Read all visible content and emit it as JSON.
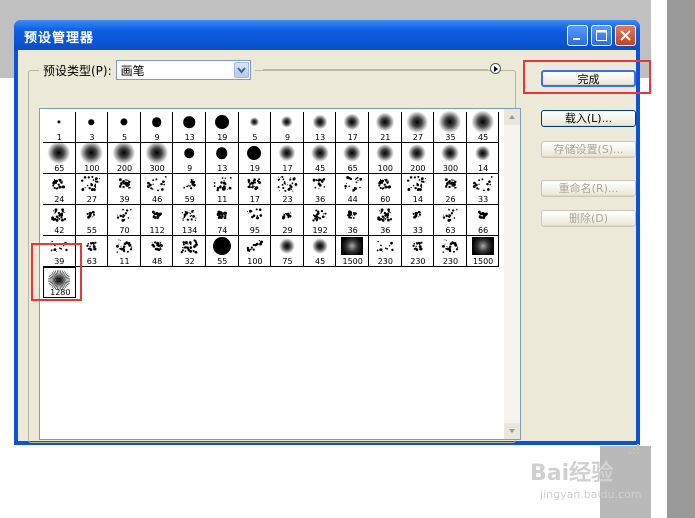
{
  "window": {
    "title": "预设管理器",
    "minimize": "minimize",
    "maximize": "maximize",
    "close": "close"
  },
  "preset_type": {
    "label": "预设类型(P):",
    "value": "画笔"
  },
  "buttons": {
    "done": "完成",
    "load": "载入(L)...",
    "save": "存储设置(S)...",
    "rename": "重命名(R)...",
    "delete": "删除(D)"
  },
  "brushes": [
    [
      "1",
      "3",
      "5",
      "9",
      "13",
      "19",
      "5",
      "9",
      "13",
      "17",
      "21",
      "27",
      "35",
      "45"
    ],
    [
      "65",
      "100",
      "200",
      "300",
      "9",
      "13",
      "19",
      "17",
      "45",
      "65",
      "100",
      "200",
      "300",
      "14"
    ],
    [
      "24",
      "27",
      "39",
      "46",
      "59",
      "11",
      "17",
      "23",
      "36",
      "44",
      "60",
      "14",
      "26",
      "33"
    ],
    [
      "42",
      "55",
      "70",
      "112",
      "134",
      "74",
      "95",
      "29",
      "192",
      "36",
      "36",
      "33",
      "63",
      "66"
    ],
    [
      "39",
      "63",
      "11",
      "48",
      "32",
      "55",
      "100",
      "75",
      "45",
      "1500",
      "230",
      "230",
      "230",
      "1500"
    ],
    [
      "1280"
    ]
  ],
  "watermark": {
    "brand": "Bai经验",
    "url": "jingyan.baidu.com"
  }
}
